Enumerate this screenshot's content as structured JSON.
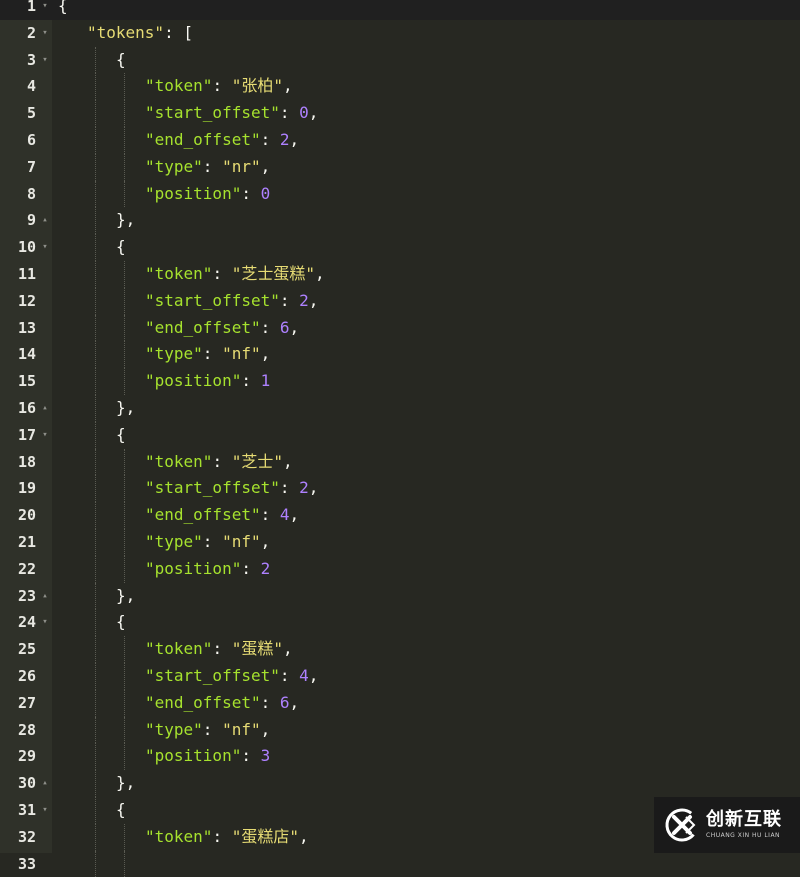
{
  "editor": {
    "lines": [
      {
        "n": "1",
        "fold": "open",
        "indent": 0,
        "tokens": [
          [
            "pun",
            "{"
          ]
        ],
        "active": true
      },
      {
        "n": "2",
        "fold": "open",
        "indent": 1,
        "tokens": [
          [
            "str",
            "\"tokens\""
          ],
          [
            "pun",
            ": ["
          ]
        ]
      },
      {
        "n": "3",
        "fold": "open",
        "indent": 2,
        "tokens": [
          [
            "pun",
            "{"
          ]
        ]
      },
      {
        "n": "4",
        "fold": "",
        "indent": 3,
        "tokens": [
          [
            "key",
            "\"token\""
          ],
          [
            "pun",
            ": "
          ],
          [
            "str",
            "\"张柏\""
          ],
          [
            "pun",
            ","
          ]
        ]
      },
      {
        "n": "5",
        "fold": "",
        "indent": 3,
        "tokens": [
          [
            "key",
            "\"start_offset\""
          ],
          [
            "pun",
            ": "
          ],
          [
            "num",
            "0"
          ],
          [
            "pun",
            ","
          ]
        ]
      },
      {
        "n": "6",
        "fold": "",
        "indent": 3,
        "tokens": [
          [
            "key",
            "\"end_offset\""
          ],
          [
            "pun",
            ": "
          ],
          [
            "num",
            "2"
          ],
          [
            "pun",
            ","
          ]
        ]
      },
      {
        "n": "7",
        "fold": "",
        "indent": 3,
        "tokens": [
          [
            "key",
            "\"type\""
          ],
          [
            "pun",
            ": "
          ],
          [
            "str",
            "\"nr\""
          ],
          [
            "pun",
            ","
          ]
        ]
      },
      {
        "n": "8",
        "fold": "",
        "indent": 3,
        "tokens": [
          [
            "key",
            "\"position\""
          ],
          [
            "pun",
            ": "
          ],
          [
            "num",
            "0"
          ]
        ]
      },
      {
        "n": "9",
        "fold": "close",
        "indent": 2,
        "tokens": [
          [
            "pun",
            "},"
          ]
        ]
      },
      {
        "n": "10",
        "fold": "open",
        "indent": 2,
        "tokens": [
          [
            "pun",
            "{"
          ]
        ]
      },
      {
        "n": "11",
        "fold": "",
        "indent": 3,
        "tokens": [
          [
            "key",
            "\"token\""
          ],
          [
            "pun",
            ": "
          ],
          [
            "str",
            "\"芝士蛋糕\""
          ],
          [
            "pun",
            ","
          ]
        ]
      },
      {
        "n": "12",
        "fold": "",
        "indent": 3,
        "tokens": [
          [
            "key",
            "\"start_offset\""
          ],
          [
            "pun",
            ": "
          ],
          [
            "num",
            "2"
          ],
          [
            "pun",
            ","
          ]
        ]
      },
      {
        "n": "13",
        "fold": "",
        "indent": 3,
        "tokens": [
          [
            "key",
            "\"end_offset\""
          ],
          [
            "pun",
            ": "
          ],
          [
            "num",
            "6"
          ],
          [
            "pun",
            ","
          ]
        ]
      },
      {
        "n": "14",
        "fold": "",
        "indent": 3,
        "tokens": [
          [
            "key",
            "\"type\""
          ],
          [
            "pun",
            ": "
          ],
          [
            "str",
            "\"nf\""
          ],
          [
            "pun",
            ","
          ]
        ]
      },
      {
        "n": "15",
        "fold": "",
        "indent": 3,
        "tokens": [
          [
            "key",
            "\"position\""
          ],
          [
            "pun",
            ": "
          ],
          [
            "num",
            "1"
          ]
        ]
      },
      {
        "n": "16",
        "fold": "close",
        "indent": 2,
        "tokens": [
          [
            "pun",
            "},"
          ]
        ]
      },
      {
        "n": "17",
        "fold": "open",
        "indent": 2,
        "tokens": [
          [
            "pun",
            "{"
          ]
        ]
      },
      {
        "n": "18",
        "fold": "",
        "indent": 3,
        "tokens": [
          [
            "key",
            "\"token\""
          ],
          [
            "pun",
            ": "
          ],
          [
            "str",
            "\"芝士\""
          ],
          [
            "pun",
            ","
          ]
        ]
      },
      {
        "n": "19",
        "fold": "",
        "indent": 3,
        "tokens": [
          [
            "key",
            "\"start_offset\""
          ],
          [
            "pun",
            ": "
          ],
          [
            "num",
            "2"
          ],
          [
            "pun",
            ","
          ]
        ]
      },
      {
        "n": "20",
        "fold": "",
        "indent": 3,
        "tokens": [
          [
            "key",
            "\"end_offset\""
          ],
          [
            "pun",
            ": "
          ],
          [
            "num",
            "4"
          ],
          [
            "pun",
            ","
          ]
        ]
      },
      {
        "n": "21",
        "fold": "",
        "indent": 3,
        "tokens": [
          [
            "key",
            "\"type\""
          ],
          [
            "pun",
            ": "
          ],
          [
            "str",
            "\"nf\""
          ],
          [
            "pun",
            ","
          ]
        ]
      },
      {
        "n": "22",
        "fold": "",
        "indent": 3,
        "tokens": [
          [
            "key",
            "\"position\""
          ],
          [
            "pun",
            ": "
          ],
          [
            "num",
            "2"
          ]
        ]
      },
      {
        "n": "23",
        "fold": "close",
        "indent": 2,
        "tokens": [
          [
            "pun",
            "},"
          ]
        ]
      },
      {
        "n": "24",
        "fold": "open",
        "indent": 2,
        "tokens": [
          [
            "pun",
            "{"
          ]
        ]
      },
      {
        "n": "25",
        "fold": "",
        "indent": 3,
        "tokens": [
          [
            "key",
            "\"token\""
          ],
          [
            "pun",
            ": "
          ],
          [
            "str",
            "\"蛋糕\""
          ],
          [
            "pun",
            ","
          ]
        ]
      },
      {
        "n": "26",
        "fold": "",
        "indent": 3,
        "tokens": [
          [
            "key",
            "\"start_offset\""
          ],
          [
            "pun",
            ": "
          ],
          [
            "num",
            "4"
          ],
          [
            "pun",
            ","
          ]
        ]
      },
      {
        "n": "27",
        "fold": "",
        "indent": 3,
        "tokens": [
          [
            "key",
            "\"end_offset\""
          ],
          [
            "pun",
            ": "
          ],
          [
            "num",
            "6"
          ],
          [
            "pun",
            ","
          ]
        ]
      },
      {
        "n": "28",
        "fold": "",
        "indent": 3,
        "tokens": [
          [
            "key",
            "\"type\""
          ],
          [
            "pun",
            ": "
          ],
          [
            "str",
            "\"nf\""
          ],
          [
            "pun",
            ","
          ]
        ]
      },
      {
        "n": "29",
        "fold": "",
        "indent": 3,
        "tokens": [
          [
            "key",
            "\"position\""
          ],
          [
            "pun",
            ": "
          ],
          [
            "num",
            "3"
          ]
        ]
      },
      {
        "n": "30",
        "fold": "close",
        "indent": 2,
        "tokens": [
          [
            "pun",
            "},"
          ]
        ]
      },
      {
        "n": "31",
        "fold": "open",
        "indent": 2,
        "tokens": [
          [
            "pun",
            "{"
          ]
        ]
      },
      {
        "n": "32",
        "fold": "",
        "indent": 3,
        "tokens": [
          [
            "key",
            "\"token\""
          ],
          [
            "pun",
            ": "
          ],
          [
            "str",
            "\"蛋糕店\""
          ],
          [
            "pun",
            ","
          ]
        ]
      },
      {
        "n": "33",
        "fold": "",
        "indent": 3,
        "tokens": []
      }
    ]
  },
  "watermark": {
    "brand_cn": "创新互联",
    "brand_en": "CHUANG XIN HU LIAN",
    "logo_icon": "cx-logo-icon"
  }
}
